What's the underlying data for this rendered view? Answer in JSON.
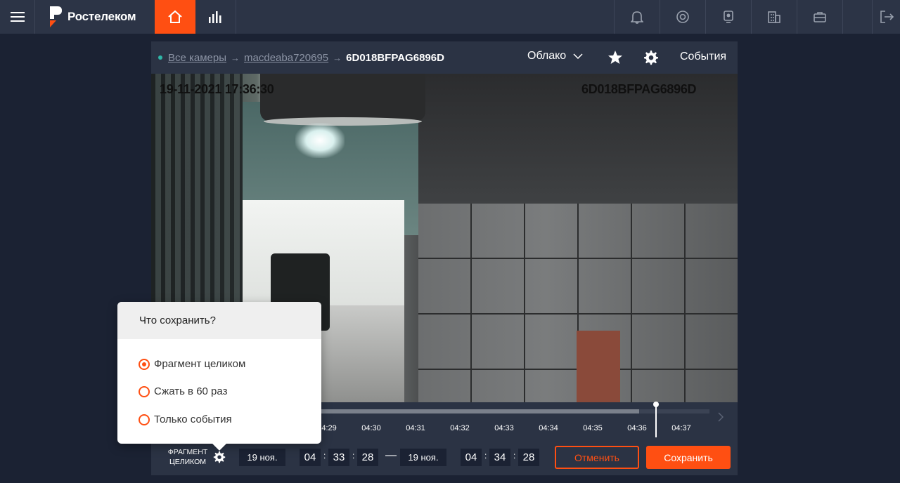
{
  "app": {
    "brand": "Ростелеком"
  },
  "breadcrumb": {
    "all_cameras": "Все камеры",
    "device": "macdeaba720695",
    "camera": "6D018BFPAG6896D"
  },
  "storage": {
    "selected": "Облако"
  },
  "events_label": "События",
  "video": {
    "timestamp": "19-11-2021 17:36:30",
    "camera_id": "6D018BFPAG6896D"
  },
  "timeline": {
    "ticks": [
      "04:29",
      "04:30",
      "04:31",
      "04:32",
      "04:33",
      "04:34",
      "04:35",
      "04:36",
      "04:37"
    ],
    "played_fraction": 0.82
  },
  "save_popup": {
    "title": "Что сохранить?",
    "options": [
      "Фрагмент целиком",
      "Сжать в 60 раз",
      "Только события"
    ],
    "selected_index": 0
  },
  "controls": {
    "fragment_label": "ФРАГМЕНТ ЦЕЛИКОМ",
    "start": {
      "date": "19 ноя.",
      "hh": "04",
      "mm": "33",
      "ss": "28"
    },
    "end": {
      "date": "19 ноя.",
      "hh": "04",
      "mm": "34",
      "ss": "28"
    },
    "cancel_label": "Отменить",
    "save_label": "Сохранить"
  },
  "colors": {
    "accent": "#ff4f12",
    "topbar": "#2c3446",
    "background": "#1b2233",
    "panel": "#2b3344"
  }
}
